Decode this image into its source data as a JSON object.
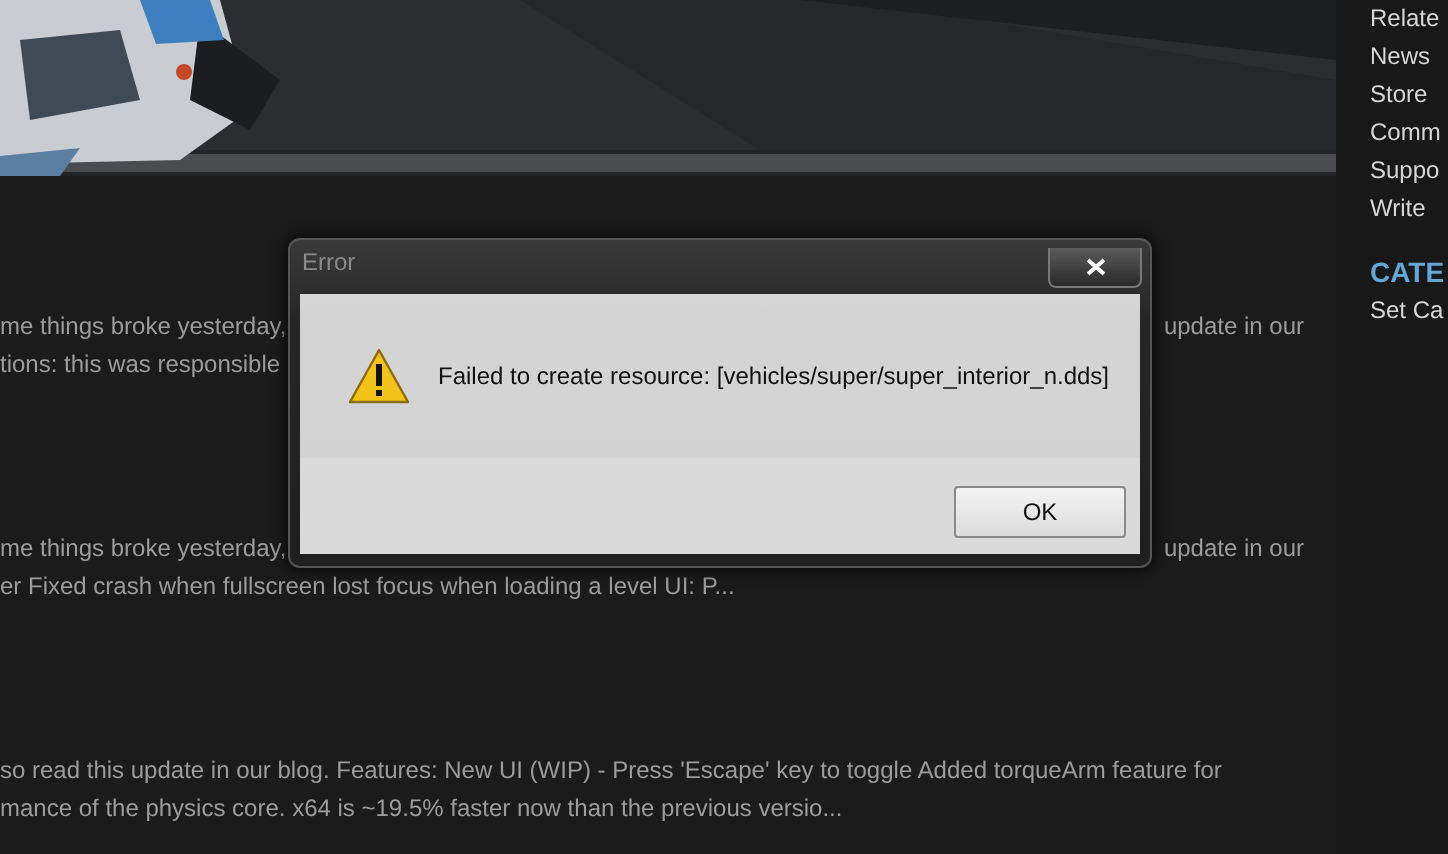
{
  "posts": [
    {
      "lines": [
        {
          "left": "me things broke yesterday,",
          "right": "update in our"
        },
        {
          "left": "tions: this was responsible"
        }
      ]
    },
    {
      "lines": [
        {
          "left": "me things broke yesterday,",
          "right": "update in our"
        },
        {
          "left": "er Fixed crash when fullscreen lost focus when loading a level UI: P..."
        }
      ]
    },
    {
      "lines": [
        {
          "left": "so read this update in our blog. Features: New UI (WIP) - Press 'Escape' key to toggle Added torqueArm feature for"
        },
        {
          "left": "mance of the physics core. x64 is ~19.5% faster now than the previous versio..."
        }
      ]
    }
  ],
  "sidebar": {
    "links": [
      "Relate",
      "News",
      "Store",
      "Comm",
      "Suppo",
      "Write"
    ],
    "heading": "CATE",
    "items": [
      "Set Ca"
    ]
  },
  "dialog": {
    "title": "Error",
    "message": "Failed to create resource: [vehicles/super/super_interior_n.dds]",
    "buttons": [
      "OK"
    ]
  }
}
